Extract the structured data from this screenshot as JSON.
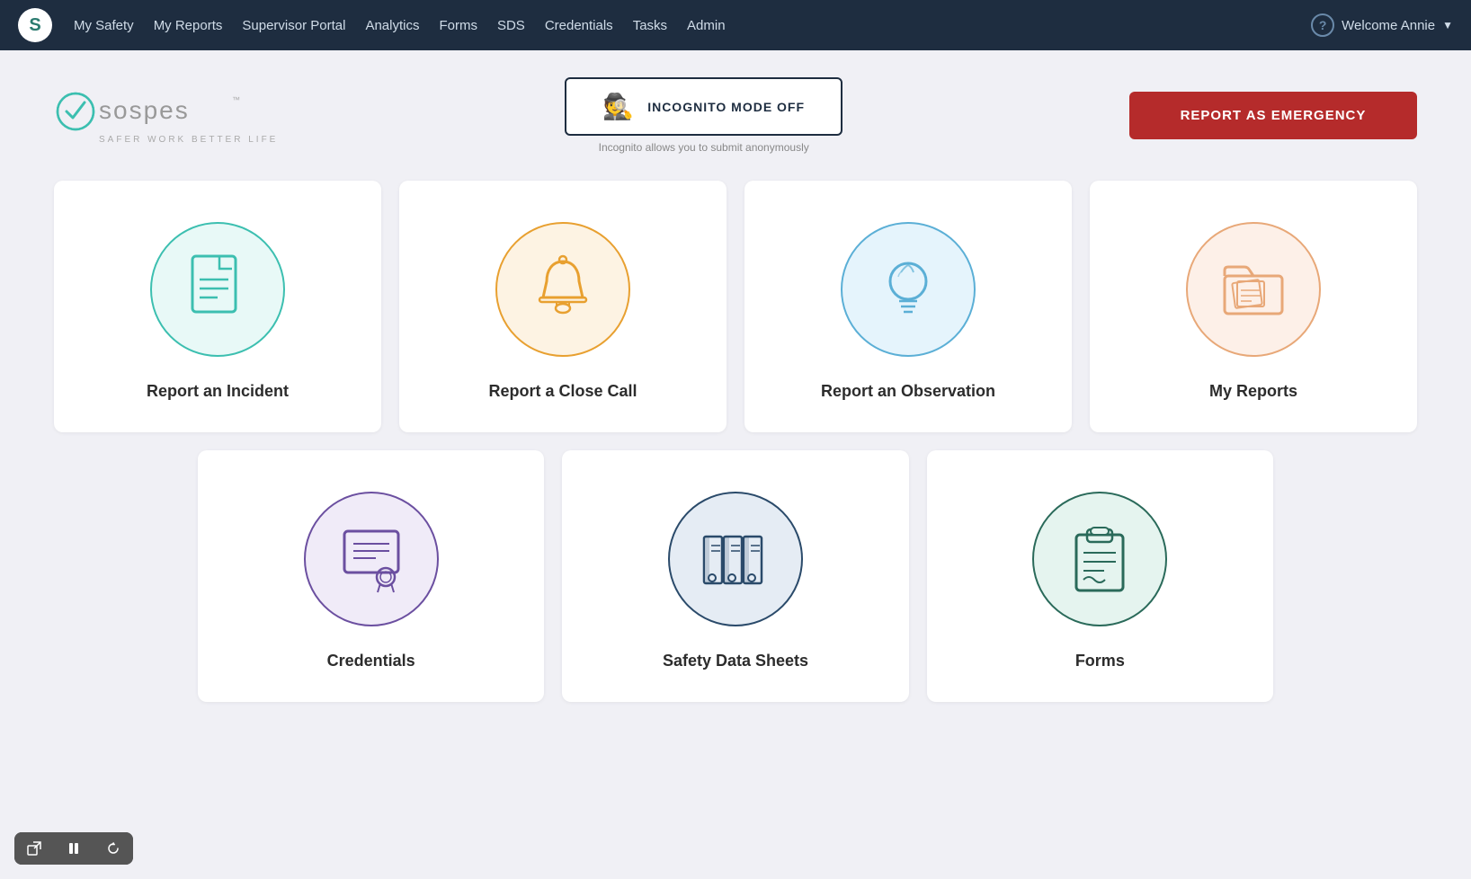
{
  "navbar": {
    "logo_letter": "S",
    "items": [
      {
        "label": "My Safety",
        "id": "my-safety"
      },
      {
        "label": "My Reports",
        "id": "my-reports"
      },
      {
        "label": "Supervisor Portal",
        "id": "supervisor-portal"
      },
      {
        "label": "Analytics",
        "id": "analytics"
      },
      {
        "label": "Forms",
        "id": "forms"
      },
      {
        "label": "SDS",
        "id": "sds"
      },
      {
        "label": "Credentials",
        "id": "credentials"
      },
      {
        "label": "Tasks",
        "id": "tasks"
      },
      {
        "label": "Admin",
        "id": "admin"
      }
    ],
    "welcome_text": "Welcome Annie",
    "help_icon": "?"
  },
  "brand": {
    "name": "sospes",
    "tagline": "SAFER WORK   BETTER LIFE",
    "tm": "™"
  },
  "incognito": {
    "button_label": "INCOGNITO MODE OFF",
    "sub_text": "Incognito allows you to submit anonymously"
  },
  "emergency": {
    "button_label": "REPORT AS EMERGENCY"
  },
  "top_cards": [
    {
      "id": "report-incident",
      "label": "Report an Incident",
      "icon_color": "#3cbfb0",
      "circle_color": "#e8f9f7",
      "icon_type": "document"
    },
    {
      "id": "report-close-call",
      "label": "Report a Close Call",
      "icon_color": "#e8a030",
      "circle_color": "#fdf3e3",
      "icon_type": "bell"
    },
    {
      "id": "report-observation",
      "label": "Report an Observation",
      "icon_color": "#5bafd6",
      "circle_color": "#e5f4fc",
      "icon_type": "lightbulb"
    },
    {
      "id": "my-reports",
      "label": "My Reports",
      "icon_color": "#e8a878",
      "circle_color": "#fdf0e8",
      "icon_type": "folder"
    }
  ],
  "bottom_cards": [
    {
      "id": "credentials",
      "label": "Credentials",
      "icon_color": "#6b4fa0",
      "circle_color": "#f0ebf8",
      "icon_type": "certificate"
    },
    {
      "id": "safety-data-sheets",
      "label": "Safety Data Sheets",
      "icon_color": "#2a4a6a",
      "circle_color": "#e5ecf4",
      "icon_type": "books"
    },
    {
      "id": "forms",
      "label": "Forms",
      "icon_color": "#2a6a5a",
      "circle_color": "#e5f4ef",
      "icon_type": "clipboard"
    }
  ],
  "toolbar": {
    "buttons": [
      "⬡",
      "⏸",
      "⟳"
    ]
  }
}
